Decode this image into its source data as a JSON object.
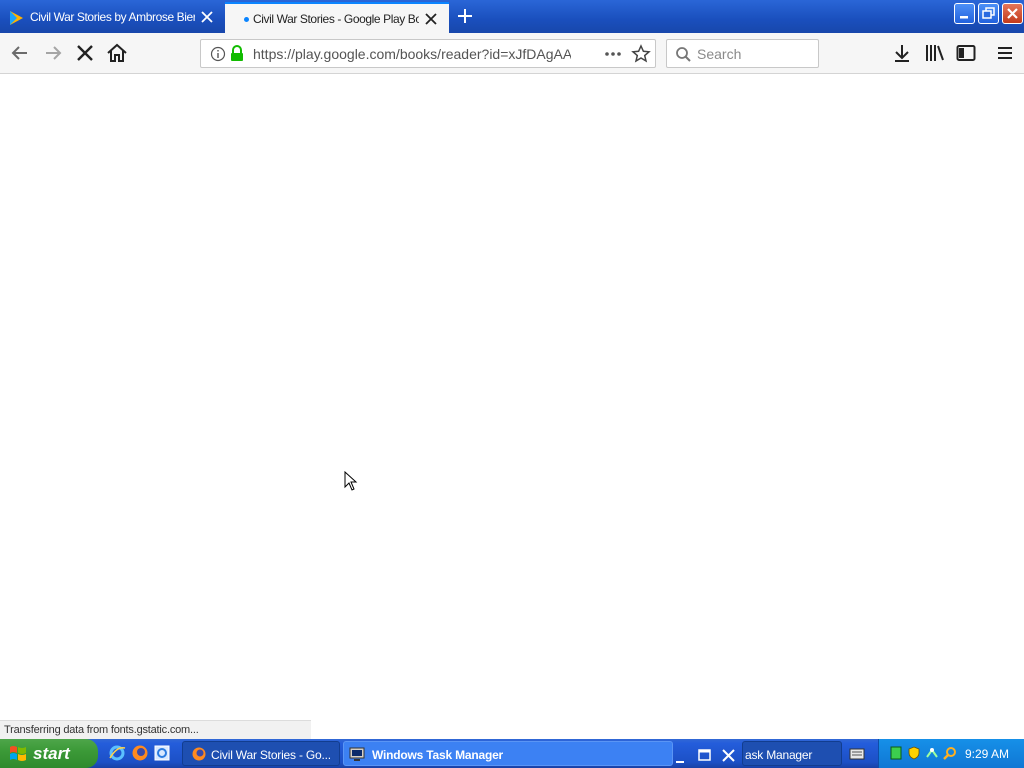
{
  "browser": {
    "tabs": [
      {
        "title": "Civil War Stories by Ambrose Bierce",
        "active": false
      },
      {
        "title": "Civil War Stories - Google Play Books",
        "active": true
      }
    ],
    "url": "https://play.google.com/books/reader?id=xJfDAgAAQBAJ",
    "search_placeholder": "Search",
    "status_text": "Transferring data from fonts.gstatic.com..."
  },
  "taskbar": {
    "start_label": "start",
    "tasks": [
      {
        "label": "Civil War Stories - Go..."
      },
      {
        "label": "Windows Task Manager"
      },
      {
        "label": "ask Manager"
      }
    ],
    "clock": "9:29 AM"
  },
  "colors": {
    "accent": "#0a84ff",
    "titlebar": "#1a4fbd",
    "taskbar": "#245ddb",
    "start": "#3c9a38"
  }
}
